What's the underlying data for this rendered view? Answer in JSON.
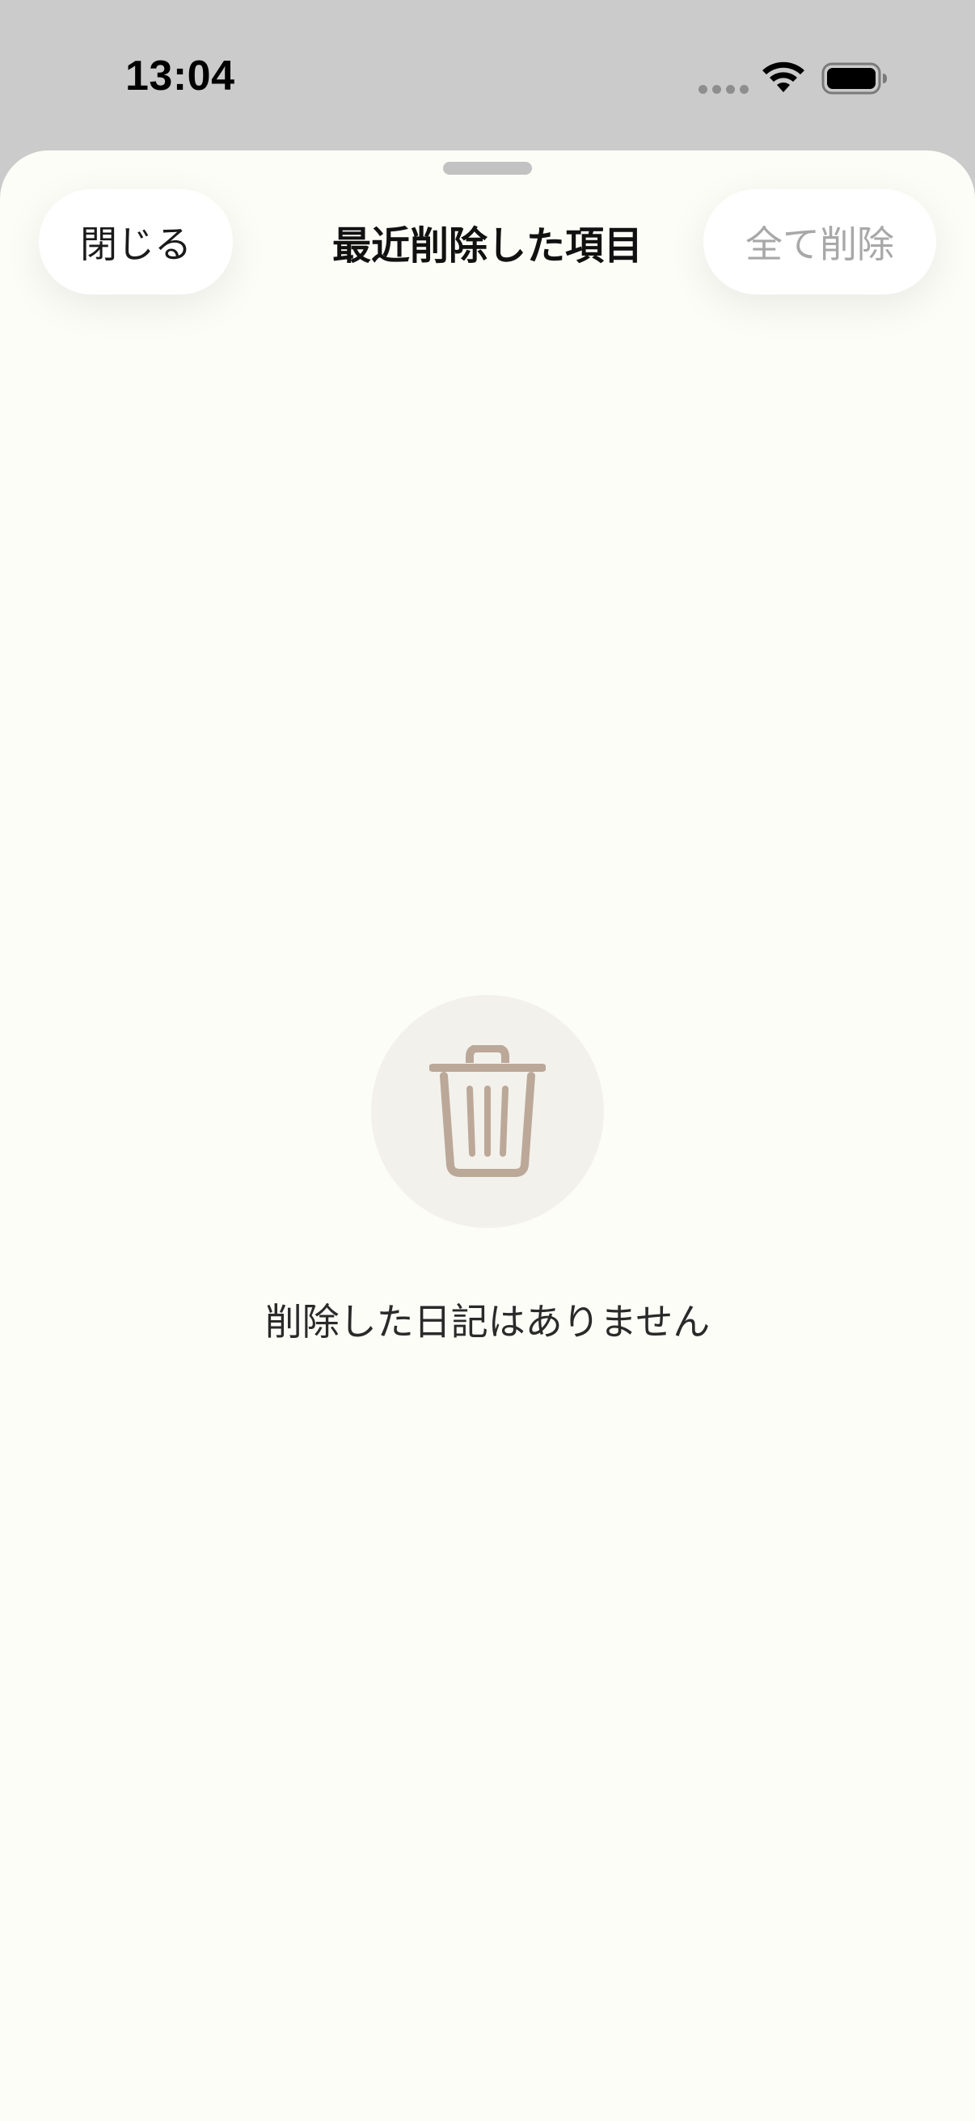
{
  "status_bar": {
    "time": "13:04",
    "icons": [
      "cellular-dots-icon",
      "wifi-icon",
      "battery-icon"
    ]
  },
  "sheet": {
    "title": "最近削除した項目",
    "close_label": "閉じる",
    "delete_all_label": "全て削除",
    "delete_all_enabled": false
  },
  "empty_state": {
    "icon": "trash-icon",
    "message": "削除した日記はありません"
  },
  "colors": {
    "status_bar_bg": "#cbcbcb",
    "sheet_bg": "#fdfdf8",
    "icon_circle_bg": "#f3f1ec",
    "trash_icon": "#bba898",
    "disabled_text": "#a8a8a8"
  }
}
